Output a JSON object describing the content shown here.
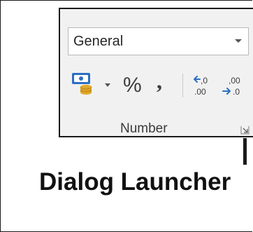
{
  "number_group": {
    "format_select": {
      "value": "General"
    },
    "buttons": {
      "accounting_icon": "currency-format-icon",
      "percent_label": "%",
      "comma_label": ",",
      "increase_decimal_icon": "increase-decimal-icon",
      "decrease_decimal_icon": "decrease-decimal-icon"
    },
    "group_label": "Number",
    "launcher_icon": "dialog-launcher-icon"
  },
  "caption": "Dialog Launcher",
  "colors": {
    "ribbon_bg": "#f1f1f1",
    "icon_blue": "#2d6fc0",
    "icon_gold": "#e0a92a",
    "text_dark": "#111111"
  }
}
